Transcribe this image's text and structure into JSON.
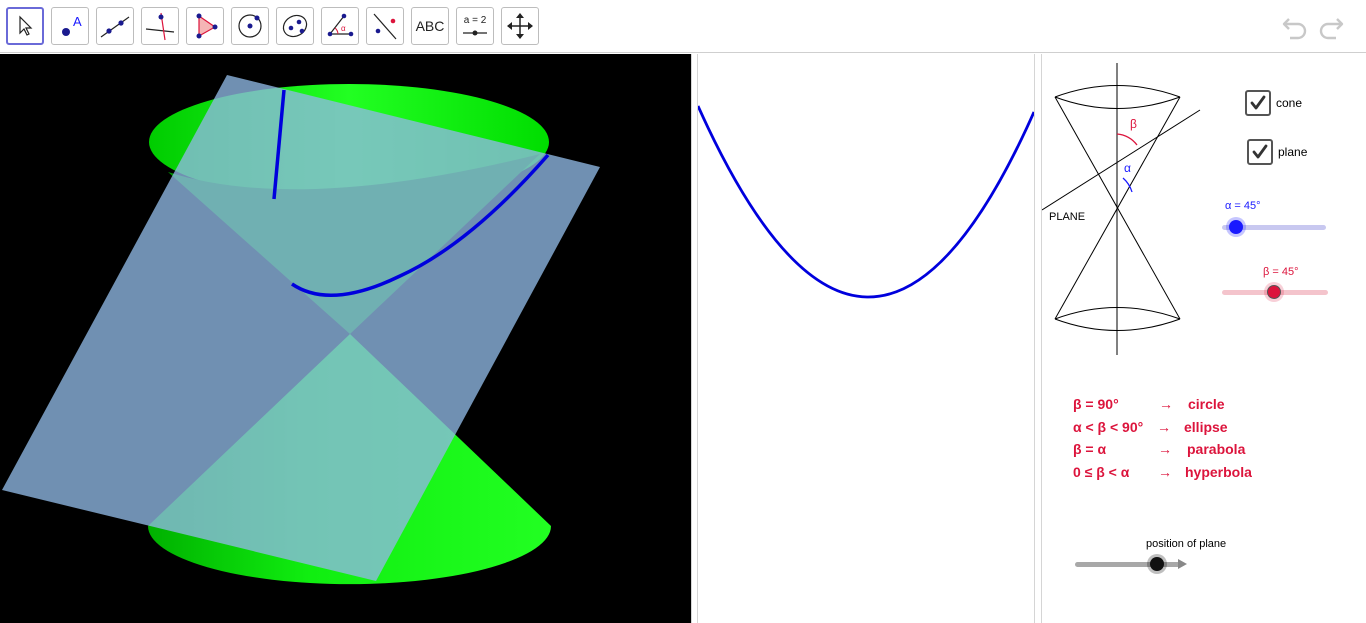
{
  "toolbar": {
    "tools": [
      {
        "name": "move-tool-button",
        "icon": "move-arrow-icon"
      },
      {
        "name": "point-tool-button",
        "icon": "point-icon",
        "label": "A"
      },
      {
        "name": "line-tool-button",
        "icon": "line-through-points-icon"
      },
      {
        "name": "perpendicular-line-tool-button",
        "icon": "perpendicular-line-icon"
      },
      {
        "name": "polygon-tool-button",
        "icon": "polygon-icon"
      },
      {
        "name": "circle-tool-button",
        "icon": "circle-center-point-icon"
      },
      {
        "name": "ellipse-tool-button",
        "icon": "ellipse-icon"
      },
      {
        "name": "angle-tool-button",
        "icon": "angle-icon"
      },
      {
        "name": "reflect-tool-button",
        "icon": "reflect-about-line-icon"
      },
      {
        "name": "text-tool-button",
        "icon": "text-icon",
        "label": "ABC"
      },
      {
        "name": "slider-tool-button",
        "icon": "slider-icon",
        "label": "a = 2"
      },
      {
        "name": "move-graphics-view-button",
        "icon": "move-view-icon"
      }
    ],
    "undo_icon": "undo-icon",
    "redo_icon": "redo-icon"
  },
  "controls": {
    "cone_label": "cone",
    "cone_checked": true,
    "plane_label": "plane",
    "plane_checked": true,
    "alpha_label": "α = 45°",
    "alpha_value_deg": 45,
    "alpha_color": "#1a1aff",
    "beta_label": "β = 45°",
    "beta_value_deg": 45,
    "beta_color": "#dc143c",
    "position_label": "position of plane"
  },
  "diagram": {
    "plane_label": "PLANE",
    "beta_symbol": "β",
    "alpha_symbol": "α"
  },
  "legend": {
    "rows": [
      {
        "condition": "β = 90°",
        "arrow": "→",
        "result": "circle"
      },
      {
        "condition": "α < β < 90°",
        "arrow": "→",
        "result": "ellipse"
      },
      {
        "condition": "β = α",
        "arrow": "→",
        "result": "parabola"
      },
      {
        "condition": "0 ≤ β < α",
        "arrow": "→",
        "result": "hyperbola"
      }
    ],
    "color": "#dc143c"
  },
  "colors": {
    "cone_green": "#00ff00",
    "plane_blue": "#7ba4cc",
    "curve_blue": "#0000dd",
    "background_3d": "#000000"
  }
}
